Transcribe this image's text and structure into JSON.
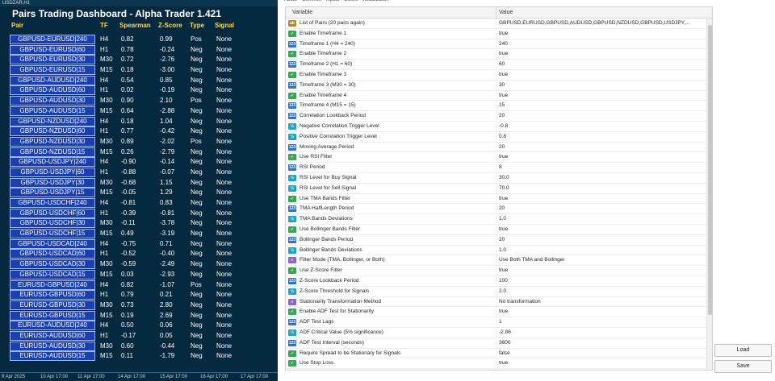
{
  "chart": {
    "symbol_label": "USDZAR,H1",
    "dashboard_title": "Pairs Trading Dashboard - Alpha Trader 1.421",
    "headers": {
      "pair": "Pair",
      "tf": "TF",
      "spearman": "Spearman",
      "zscore": "Z-Score",
      "type": "Type",
      "signal": "Signal"
    },
    "rows": [
      {
        "pair": "GBPUSD-EURUSD|240",
        "tf": "H4",
        "spearman": "0.82",
        "zscore": "0.99",
        "type": "Pos",
        "signal": "None"
      },
      {
        "pair": "GBPUSD-EURUSD|60",
        "tf": "H1",
        "spearman": "0.78",
        "zscore": "-0.24",
        "type": "Neg",
        "signal": "None"
      },
      {
        "pair": "GBPUSD-EURUSD|30",
        "tf": "M30",
        "spearman": "0.72",
        "zscore": "-2.76",
        "type": "Neg",
        "signal": "None"
      },
      {
        "pair": "GBPUSD-EURUSD|15",
        "tf": "M15",
        "spearman": "0.18",
        "zscore": "-3.00",
        "type": "Neg",
        "signal": "None"
      },
      {
        "pair": "GBPUSD-AUDUSD|240",
        "tf": "H4",
        "spearman": "0.54",
        "zscore": "0.85",
        "type": "Neg",
        "signal": "None"
      },
      {
        "pair": "GBPUSD-AUDUSD|60",
        "tf": "H1",
        "spearman": "0.02",
        "zscore": "-0.19",
        "type": "Neg",
        "signal": "None"
      },
      {
        "pair": "GBPUSD-AUDUSD|30",
        "tf": "M30",
        "spearman": "0.90",
        "zscore": "2.10",
        "type": "Pos",
        "signal": "None"
      },
      {
        "pair": "GBPUSD-AUDUSD|15",
        "tf": "M15",
        "spearman": "0.64",
        "zscore": "-2.88",
        "type": "Neg",
        "signal": "None"
      },
      {
        "pair": "GBPUSD-NZDUSD|240",
        "tf": "H4",
        "spearman": "0.18",
        "zscore": "1.04",
        "type": "Neg",
        "signal": "None"
      },
      {
        "pair": "GBPUSD-NZDUSD|60",
        "tf": "H1",
        "spearman": "0.77",
        "zscore": "-0.42",
        "type": "Neg",
        "signal": "None"
      },
      {
        "pair": "GBPUSD-NZDUSD|30",
        "tf": "M30",
        "spearman": "0.89",
        "zscore": "-2.02",
        "type": "Pos",
        "signal": "None"
      },
      {
        "pair": "GBPUSD-NZDUSD|15",
        "tf": "M15",
        "spearman": "0.26",
        "zscore": "-2.79",
        "type": "Neg",
        "signal": "None"
      },
      {
        "pair": "GBPUSD-USDJPY|240",
        "tf": "H4",
        "spearman": "-0.90",
        "zscore": "-0.14",
        "type": "Neg",
        "signal": "None"
      },
      {
        "pair": "GBPUSD-USDJPY|60",
        "tf": "H1",
        "spearman": "-0.88",
        "zscore": "-0.07",
        "type": "Neg",
        "signal": "None"
      },
      {
        "pair": "GBPUSD-USDJPY|30",
        "tf": "M30",
        "spearman": "-0.68",
        "zscore": "1.15",
        "type": "Neg",
        "signal": "None"
      },
      {
        "pair": "GBPUSD-USDJPY|15",
        "tf": "M15",
        "spearman": "-0.05",
        "zscore": "1.29",
        "type": "Neg",
        "signal": "None"
      },
      {
        "pair": "GBPUSD-USDCHF|240",
        "tf": "H4",
        "spearman": "-0.81",
        "zscore": "0.83",
        "type": "Neg",
        "signal": "None"
      },
      {
        "pair": "GBPUSD-USDCHF|60",
        "tf": "H1",
        "spearman": "-0.39",
        "zscore": "-0.81",
        "type": "Neg",
        "signal": "None"
      },
      {
        "pair": "GBPUSD-USDCHF|30",
        "tf": "M30",
        "spearman": "-0.11",
        "zscore": "-3.78",
        "type": "Neg",
        "signal": "None"
      },
      {
        "pair": "GBPUSD-USDCHF|15",
        "tf": "M15",
        "spearman": "0.49",
        "zscore": "-3.19",
        "type": "Neg",
        "signal": "None"
      },
      {
        "pair": "GBPUSD-USDCAD|240",
        "tf": "H4",
        "spearman": "-0.75",
        "zscore": "0.71",
        "type": "Neg",
        "signal": "None"
      },
      {
        "pair": "GBPUSD-USDCAD|60",
        "tf": "H1",
        "spearman": "-0.52",
        "zscore": "-0.40",
        "type": "Neg",
        "signal": "None"
      },
      {
        "pair": "GBPUSD-USDCAD|30",
        "tf": "M30",
        "spearman": "-0.59",
        "zscore": "-2.49",
        "type": "Neg",
        "signal": "None"
      },
      {
        "pair": "GBPUSD-USDCAD|15",
        "tf": "M15",
        "spearman": "0.03",
        "zscore": "-2.93",
        "type": "Neg",
        "signal": "None"
      },
      {
        "pair": "EURUSD-GBPUSD|240",
        "tf": "H4",
        "spearman": "0.82",
        "zscore": "-1.07",
        "type": "Pos",
        "signal": "None"
      },
      {
        "pair": "EURUSD-GBPUSD|60",
        "tf": "H1",
        "spearman": "0.79",
        "zscore": "0.21",
        "type": "Neg",
        "signal": "None"
      },
      {
        "pair": "EURUSD-GBPUSD|30",
        "tf": "M30",
        "spearman": "0.73",
        "zscore": "2.80",
        "type": "Neg",
        "signal": "None"
      },
      {
        "pair": "EURUSD-GBPUSD|15",
        "tf": "M15",
        "spearman": "0.19",
        "zscore": "2.69",
        "type": "Neg",
        "signal": "None"
      },
      {
        "pair": "EURUSD-AUDUSD|240",
        "tf": "H4",
        "spearman": "0.50",
        "zscore": "0.06",
        "type": "Neg",
        "signal": "None"
      },
      {
        "pair": "EURUSD-AUDUSD|60",
        "tf": "H1",
        "spearman": "-0.17",
        "zscore": "0.05",
        "type": "Neg",
        "signal": "None"
      },
      {
        "pair": "EURUSD-AUDUSD|30",
        "tf": "M30",
        "spearman": "0.60",
        "zscore": "-0.44",
        "type": "Neg",
        "signal": "None"
      },
      {
        "pair": "EURUSD-AUDUSD|15",
        "tf": "M15",
        "spearman": "0.11",
        "zscore": "-1.79",
        "type": "Neg",
        "signal": "None"
      }
    ],
    "time_labels": [
      "9 Apr 2025",
      "10 Apr 17:00",
      "11 Apr 17:00",
      "14 Apr 17:00",
      "15 Apr 17:00",
      "16 Apr 17:00",
      "17 Apr 17:00"
    ]
  },
  "dialog": {
    "tabs": [
      "About",
      "Common",
      "Inputs",
      "Colors",
      "Visualization"
    ],
    "columns": {
      "variable": "Variable",
      "value": "Value"
    },
    "params": [
      {
        "type": "str",
        "name": "List of Pairs (20 pairs again)",
        "value": "GBPUSD,EURUSD,GBPUSD,AUDUSD,GBPUSD,NZDUSD,GBPUSD,USDJPY,..."
      },
      {
        "type": "bool",
        "name": "Enable Timeframe 1",
        "value": "true"
      },
      {
        "type": "int",
        "name": "Timeframe 1 (H4 = 240)",
        "value": "240"
      },
      {
        "type": "bool",
        "name": "Enable Timeframe 2",
        "value": "true"
      },
      {
        "type": "int",
        "name": "Timeframe 2 (H1 = 60)",
        "value": "60"
      },
      {
        "type": "bool",
        "name": "Enable Timeframe 3",
        "value": "true"
      },
      {
        "type": "int",
        "name": "Timeframe 3 (M30 = 30)",
        "value": "30"
      },
      {
        "type": "bool",
        "name": "Enable Timeframe 4",
        "value": "true"
      },
      {
        "type": "int",
        "name": "Timeframe 4 (M15 = 15)",
        "value": "15"
      },
      {
        "type": "int",
        "name": "Correlation Lookback Period",
        "value": "20"
      },
      {
        "type": "dbl",
        "name": "Negative Correlation Trigger Level",
        "value": "-0.8"
      },
      {
        "type": "dbl",
        "name": "Positive Correlation Trigger Level",
        "value": "0.8"
      },
      {
        "type": "int",
        "name": "Moving Average Period",
        "value": "20"
      },
      {
        "type": "bool",
        "name": "Use RSI Filter",
        "value": "true"
      },
      {
        "type": "int",
        "name": "RSI Period",
        "value": "8"
      },
      {
        "type": "dbl",
        "name": "RSI Level for Buy Signal",
        "value": "30.0"
      },
      {
        "type": "dbl",
        "name": "RSI Level for Sell Signal",
        "value": "70.0"
      },
      {
        "type": "bool",
        "name": "Use TMA Bands Filter",
        "value": "true"
      },
      {
        "type": "int",
        "name": "TMA HalfLength Period",
        "value": "20"
      },
      {
        "type": "dbl",
        "name": "TMA Bands Deviations",
        "value": "1.0"
      },
      {
        "type": "bool",
        "name": "Use Bollinger Bands Filter",
        "value": "true"
      },
      {
        "type": "int",
        "name": "Bollinger Bands Period",
        "value": "20"
      },
      {
        "type": "dbl",
        "name": "Bollinger Bands Deviations",
        "value": "1.0"
      },
      {
        "type": "enum",
        "name": "Filter Mode (TMA, Bollinger, or Both)",
        "value": "Use Both TMA and Bollinger"
      },
      {
        "type": "bool",
        "name": "Use Z-Score Filter",
        "value": "true"
      },
      {
        "type": "int",
        "name": "Z-Score Lookback Period",
        "value": "100"
      },
      {
        "type": "dbl",
        "name": "Z-Score Threshold for Signals",
        "value": "2.0"
      },
      {
        "type": "enum",
        "name": "Stationarity Transformation Method",
        "value": "No transformation"
      },
      {
        "type": "bool",
        "name": "Enable ADF Test for Stationarity",
        "value": "true"
      },
      {
        "type": "int",
        "name": "ADF Test Lags",
        "value": "1"
      },
      {
        "type": "dbl",
        "name": "ADF Critical Value (5% significance)",
        "value": "-2.86"
      },
      {
        "type": "int",
        "name": "ADF Test Interval (seconds)",
        "value": "3600"
      },
      {
        "type": "bool",
        "name": "Require Spread to be Stationary for Signals",
        "value": "false"
      },
      {
        "type": "bool",
        "name": "Use Stop Loss",
        "value": "true"
      }
    ],
    "buttons": {
      "load": "Load",
      "save": "Save"
    }
  }
}
